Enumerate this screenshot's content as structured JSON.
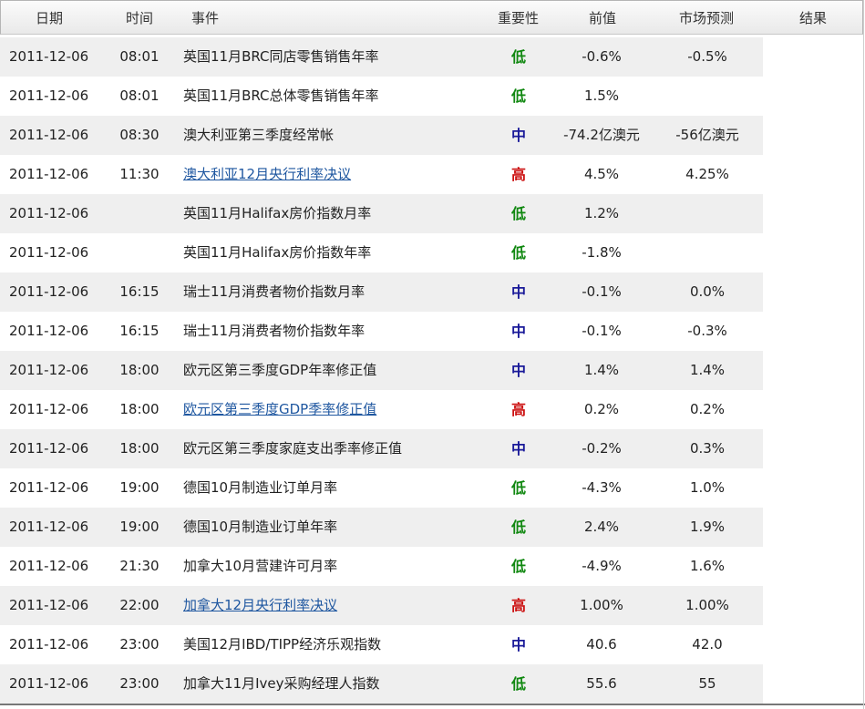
{
  "columns": {
    "date": "日期",
    "time": "时间",
    "event": "事件",
    "importance": "重要性",
    "previous": "前值",
    "forecast": "市场预测",
    "result": "结果"
  },
  "colors": {
    "low": "#118811",
    "medium": "#1a1a99",
    "high": "#cc1111",
    "link": "#1f57a0"
  },
  "rows": [
    {
      "date": "2011-12-06",
      "time": "08:01",
      "event": "英国11月BRC同店零售销售年率",
      "link": false,
      "importance": "低",
      "level": "low",
      "previous": "-0.6%",
      "forecast": "-0.5%",
      "result": ""
    },
    {
      "date": "2011-12-06",
      "time": "08:01",
      "event": "英国11月BRC总体零售销售年率",
      "link": false,
      "importance": "低",
      "level": "low",
      "previous": "1.5%",
      "forecast": "",
      "result": ""
    },
    {
      "date": "2011-12-06",
      "time": "08:30",
      "event": "澳大利亚第三季度经常帐",
      "link": false,
      "importance": "中",
      "level": "medium",
      "previous": "-74.2亿澳元",
      "forecast": "-56亿澳元",
      "result": ""
    },
    {
      "date": "2011-12-06",
      "time": "11:30",
      "event": "澳大利亚12月央行利率决议",
      "link": true,
      "importance": "高",
      "level": "high",
      "previous": "4.5%",
      "forecast": "4.25%",
      "result": ""
    },
    {
      "date": "2011-12-06",
      "time": "",
      "event": "英国11月Halifax房价指数月率",
      "link": false,
      "importance": "低",
      "level": "low",
      "previous": "1.2%",
      "forecast": "",
      "result": ""
    },
    {
      "date": "2011-12-06",
      "time": "",
      "event": "英国11月Halifax房价指数年率",
      "link": false,
      "importance": "低",
      "level": "low",
      "previous": "-1.8%",
      "forecast": "",
      "result": ""
    },
    {
      "date": "2011-12-06",
      "time": "16:15",
      "event": "瑞士11月消费者物价指数月率",
      "link": false,
      "importance": "中",
      "level": "medium",
      "previous": "-0.1%",
      "forecast": "0.0%",
      "result": ""
    },
    {
      "date": "2011-12-06",
      "time": "16:15",
      "event": "瑞士11月消费者物价指数年率",
      "link": false,
      "importance": "中",
      "level": "medium",
      "previous": "-0.1%",
      "forecast": "-0.3%",
      "result": ""
    },
    {
      "date": "2011-12-06",
      "time": "18:00",
      "event": "欧元区第三季度GDP年率修正值",
      "link": false,
      "importance": "中",
      "level": "medium",
      "previous": "1.4%",
      "forecast": "1.4%",
      "result": ""
    },
    {
      "date": "2011-12-06",
      "time": "18:00",
      "event": "欧元区第三季度GDP季率修正值",
      "link": true,
      "importance": "高",
      "level": "high",
      "previous": "0.2%",
      "forecast": "0.2%",
      "result": ""
    },
    {
      "date": "2011-12-06",
      "time": "18:00",
      "event": "欧元区第三季度家庭支出季率修正值",
      "link": false,
      "importance": "中",
      "level": "medium",
      "previous": "-0.2%",
      "forecast": "0.3%",
      "result": ""
    },
    {
      "date": "2011-12-06",
      "time": "19:00",
      "event": "德国10月制造业订单月率",
      "link": false,
      "importance": "低",
      "level": "low",
      "previous": "-4.3%",
      "forecast": "1.0%",
      "result": ""
    },
    {
      "date": "2011-12-06",
      "time": "19:00",
      "event": "德国10月制造业订单年率",
      "link": false,
      "importance": "低",
      "level": "low",
      "previous": "2.4%",
      "forecast": "1.9%",
      "result": ""
    },
    {
      "date": "2011-12-06",
      "time": "21:30",
      "event": "加拿大10月营建许可月率",
      "link": false,
      "importance": "低",
      "level": "low",
      "previous": "-4.9%",
      "forecast": "1.6%",
      "result": ""
    },
    {
      "date": "2011-12-06",
      "time": "22:00",
      "event": "加拿大12月央行利率决议",
      "link": true,
      "importance": "高",
      "level": "high",
      "previous": "1.00%",
      "forecast": "1.00%",
      "result": ""
    },
    {
      "date": "2011-12-06",
      "time": "23:00",
      "event": "美国12月IBD/TIPP经济乐观指数",
      "link": false,
      "importance": "中",
      "level": "medium",
      "previous": "40.6",
      "forecast": "42.0",
      "result": ""
    },
    {
      "date": "2011-12-06",
      "time": "23:00",
      "event": "加拿大11月Ivey采购经理人指数",
      "link": false,
      "importance": "低",
      "level": "low",
      "previous": "55.6",
      "forecast": "55",
      "result": ""
    }
  ]
}
